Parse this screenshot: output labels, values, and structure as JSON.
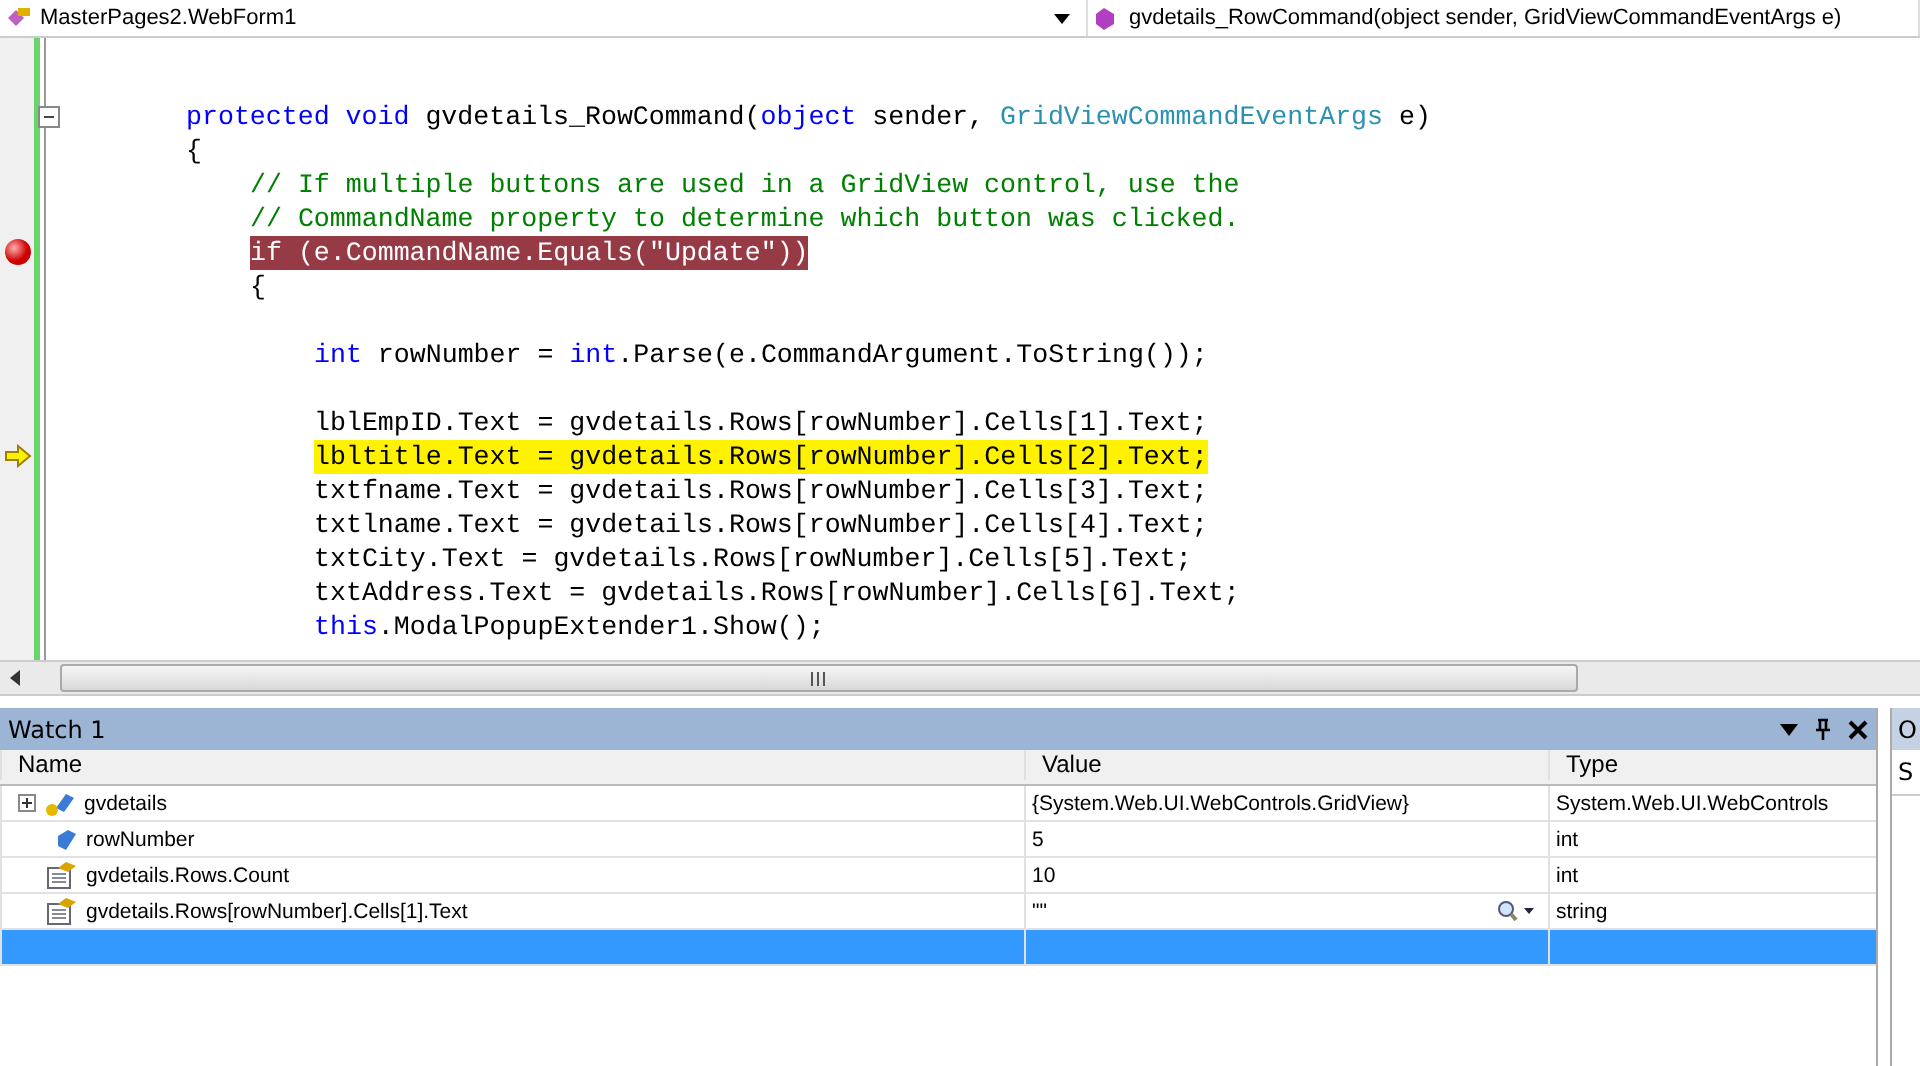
{
  "navbar": {
    "class_dropdown": "MasterPages2.WebForm1",
    "member_dropdown": "gvdetails_RowCommand(object sender, GridViewCommandEventArgs e)"
  },
  "code": {
    "lines": [
      {
        "kind": "level0",
        "collapsible": true,
        "breakpoint": false,
        "current": false,
        "tokens": [
          {
            "t": "protected void",
            "kind": "keyword"
          },
          {
            "t": " gvdetails_RowCommand(",
            "kind": "plain"
          },
          {
            "t": "object",
            "kind": "keyword"
          },
          {
            "t": " sender, ",
            "kind": "plain"
          },
          {
            "t": "GridViewCommandEventArgs",
            "kind": "type"
          },
          {
            "t": " e)",
            "kind": "plain"
          }
        ]
      },
      {
        "kind": "level0",
        "breakpoint": false,
        "current": false,
        "tokens": [
          {
            "t": "{",
            "kind": "plain"
          }
        ]
      },
      {
        "kind": "level1",
        "breakpoint": false,
        "current": false,
        "tokens": [
          {
            "t": "// If multiple buttons are used in a GridView control, use the",
            "kind": "comment"
          }
        ]
      },
      {
        "kind": "level1",
        "breakpoint": false,
        "current": false,
        "tokens": [
          {
            "t": "// CommandName property to determine which button was clicked.",
            "kind": "comment"
          }
        ]
      },
      {
        "kind": "level1",
        "breakpoint": true,
        "current": false,
        "tokens": [
          {
            "t": "if (e.CommandName.Equals(\"Update\"))",
            "kind": "plain"
          }
        ]
      },
      {
        "kind": "level1",
        "breakpoint": false,
        "current": false,
        "tokens": [
          {
            "t": "{",
            "kind": "plain"
          }
        ]
      },
      {
        "kind": "blank"
      },
      {
        "kind": "level2",
        "breakpoint": false,
        "current": false,
        "tokens": [
          {
            "t": "int",
            "kind": "keyword"
          },
          {
            "t": " rowNumber = ",
            "kind": "plain"
          },
          {
            "t": "int",
            "kind": "keyword"
          },
          {
            "t": ".Parse(e.CommandArgument.ToString());",
            "kind": "plain"
          }
        ]
      },
      {
        "kind": "blank"
      },
      {
        "kind": "level2",
        "breakpoint": false,
        "current": false,
        "tokens": [
          {
            "t": "lblEmpID.Text = gvdetails.Rows[rowNumber].Cells[1].Text;",
            "kind": "plain"
          }
        ]
      },
      {
        "kind": "level2",
        "breakpoint": false,
        "current": true,
        "tokens": [
          {
            "t": "lbltitle.Text = gvdetails.Rows[rowNumber].Cells[2].Text;",
            "kind": "plain"
          }
        ]
      },
      {
        "kind": "level2",
        "breakpoint": false,
        "current": false,
        "tokens": [
          {
            "t": "txtfname.Text = gvdetails.Rows[rowNumber].Cells[3].Text;",
            "kind": "plain"
          }
        ]
      },
      {
        "kind": "level2",
        "breakpoint": false,
        "current": false,
        "tokens": [
          {
            "t": "txtlname.Text = gvdetails.Rows[rowNumber].Cells[4].Text;",
            "kind": "plain"
          }
        ]
      },
      {
        "kind": "level2",
        "breakpoint": false,
        "current": false,
        "tokens": [
          {
            "t": "txtCity.Text = gvdetails.Rows[rowNumber].Cells[5].Text;",
            "kind": "plain"
          }
        ]
      },
      {
        "kind": "level2",
        "breakpoint": false,
        "current": false,
        "tokens": [
          {
            "t": "txtAddress.Text = gvdetails.Rows[rowNumber].Cells[6].Text;",
            "kind": "plain"
          }
        ]
      },
      {
        "kind": "level2",
        "breakpoint": false,
        "current": false,
        "tokens": [
          {
            "t": "this",
            "kind": "keyword"
          },
          {
            "t": ".ModalPopupExtender1.Show();",
            "kind": "plain"
          }
        ]
      }
    ]
  },
  "watch": {
    "title": "Watch 1",
    "columns": [
      "Name",
      "Value",
      "Type"
    ],
    "rows": [
      {
        "kind": "object",
        "expandable": true,
        "selected": false,
        "name": "gvdetails",
        "value": "{System.Web.UI.WebControls.GridView}",
        "type": "System.Web.UI.WebControls"
      },
      {
        "kind": "field",
        "selected": false,
        "name": "rowNumber",
        "value": "5",
        "type": "int"
      },
      {
        "kind": "expression",
        "selected": false,
        "name": "gvdetails.Rows.Count",
        "value": "10",
        "type": "int"
      },
      {
        "kind": "expression",
        "visualizer": true,
        "selected": false,
        "name": "gvdetails.Rows[rowNumber].Cells[1].Text",
        "value": "\"\"",
        "type": "string"
      },
      {
        "kind": "empty",
        "selected": true
      }
    ]
  },
  "side_panel": {
    "title": "O",
    "tab": "S"
  }
}
